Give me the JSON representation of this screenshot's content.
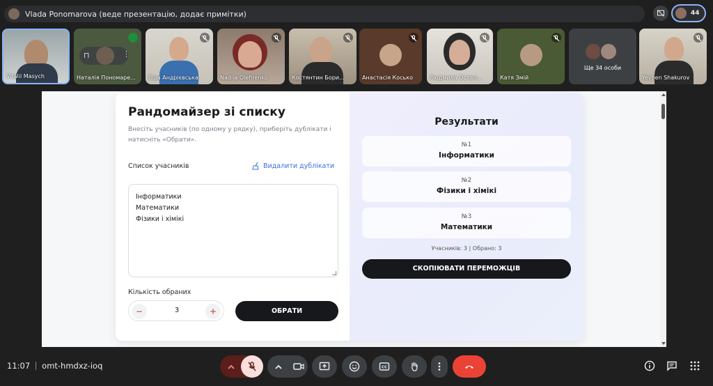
{
  "topbar": {
    "presenter_text": "Vlada Ponomarova (веде презентацію, додає примітки)",
    "people_count": "44"
  },
  "participants": [
    {
      "name": "Vitalii Masych"
    },
    {
      "name": "Наталія Пономарова",
      "label": "Наталія Пономаре..."
    },
    {
      "name": "Віра Андрієвська"
    },
    {
      "name": "Nadiia Olefirenko",
      "label": "Nadiia Olefirenko"
    },
    {
      "name": "Костянтин Борисович",
      "label": "Костянтин Бори..."
    },
    {
      "name": "Анастасія Косько"
    },
    {
      "name": "Людмила Остапенко",
      "label": "Людмила Остап..."
    },
    {
      "name": "Катя Змій"
    },
    {
      "name": "Ще 34 особи"
    },
    {
      "name": "Yevhen Shakurov"
    }
  ],
  "app": {
    "title": "Рандомайзер зі списку",
    "subtitle": "Внесіть учасників (по одному у рядку), приберіть дублікати і натисніть «Обрати».",
    "list_label": "Список учасників",
    "dedupe_label": "Видалити дублікати",
    "list_lines": [
      "Інформатики",
      "Математики",
      "Фізики і хімікі"
    ],
    "count_label": "Кількість обраних",
    "count_value": "3",
    "minus_label": "−",
    "plus_label": "+",
    "pick_label": "ОБРАТИ",
    "results_title": "Результати",
    "results": [
      {
        "num": "№1",
        "value": "Інформатики"
      },
      {
        "num": "№2",
        "value": "Фізики і хімікі"
      },
      {
        "num": "№3",
        "value": "Математики"
      }
    ],
    "stats": "Учасників: 3 | Обрано: 3",
    "copy_label": "СКОПІЮВАТИ ПЕРЕМОЖЦІВ"
  },
  "bottombar": {
    "time": "11:07",
    "meeting_code": "omt-hmdxz-ioq"
  },
  "colors": {
    "background": "#1f1f1f",
    "accent_blue": "#8ab4f8",
    "end_call": "#ea4335",
    "mic_off_bg": "#f9dedc",
    "link_blue": "#3b6fd8"
  }
}
